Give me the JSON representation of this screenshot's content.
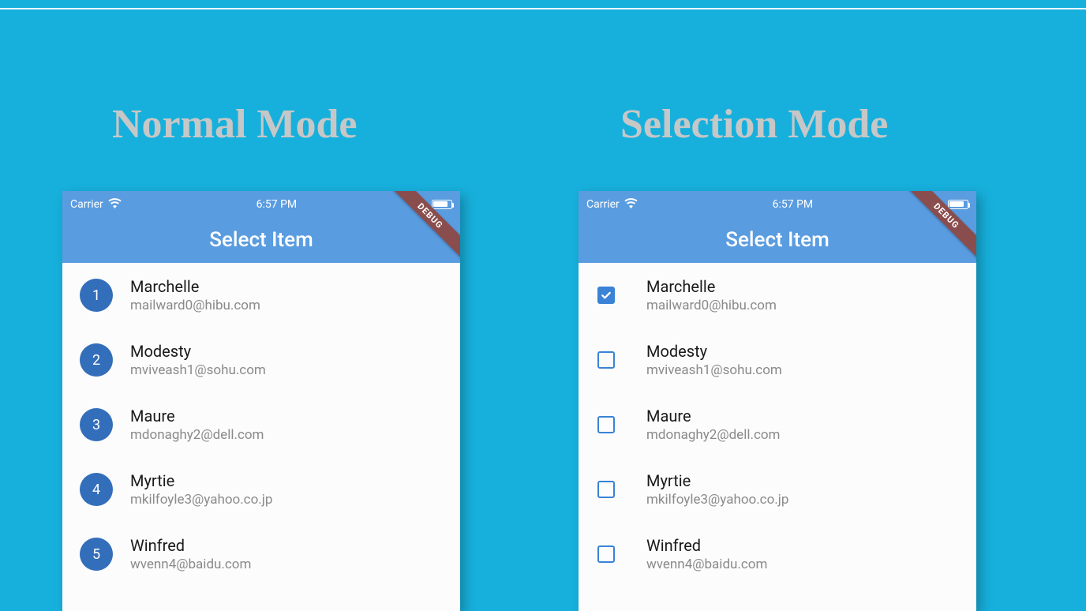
{
  "headings": {
    "left": "Normal Mode",
    "right": "Selection Mode"
  },
  "statusbar": {
    "carrier": "Carrier",
    "time": "6:57 PM"
  },
  "appbar_title": "Select Item",
  "debug_label": "DEBUG",
  "items": [
    {
      "index": "1",
      "name": "Marchelle",
      "email": "mailward0@hibu.com",
      "checked": true
    },
    {
      "index": "2",
      "name": "Modesty",
      "email": "mviveash1@sohu.com",
      "checked": false
    },
    {
      "index": "3",
      "name": "Maure",
      "email": "mdonaghy2@dell.com",
      "checked": false
    },
    {
      "index": "4",
      "name": "Myrtie",
      "email": "mkilfoyle3@yahoo.co.jp",
      "checked": false
    },
    {
      "index": "5",
      "name": "Winfred",
      "email": "wvenn4@baidu.com",
      "checked": false
    }
  ]
}
